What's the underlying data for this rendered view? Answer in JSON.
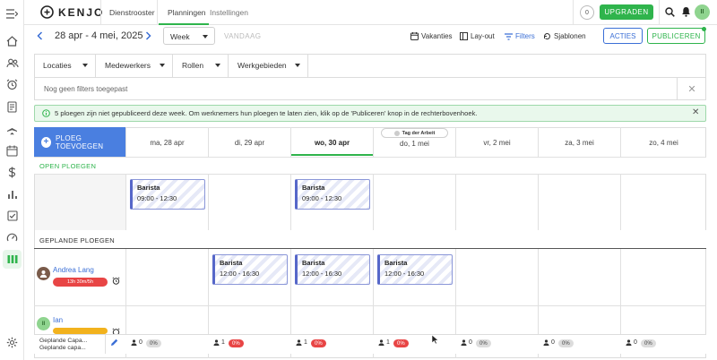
{
  "brand": {
    "name": "KENJO"
  },
  "topbar": {
    "section": "Dienstrooster",
    "tabs": [
      {
        "label": "Planningen"
      },
      {
        "label": "Instellingen"
      }
    ],
    "credits": "0",
    "upgrade_label": "UPGRADEN",
    "avatar_initials": "II"
  },
  "toolbar": {
    "date_range": "28 apr - 4 mei, 2025",
    "view_select": "Week",
    "today_label": "VANDAAG",
    "holidays_label": "Vakanties",
    "layout_label": "Lay-out",
    "filters_label": "Filters",
    "templates_label": "Sjablonen",
    "actions_label": "ACTIES",
    "publish_label": "PUBLICEREN"
  },
  "filters": {
    "dropdowns": [
      {
        "label": "Locaties"
      },
      {
        "label": "Medewerkers"
      },
      {
        "label": "Rollen"
      },
      {
        "label": "Werkgebieden"
      }
    ],
    "empty_text": "Nog geen filters toegepast"
  },
  "banner": {
    "text": "5 ploegen zijn niet gepubliceerd deze week. Om werknemers hun ploegen te laten zien, klik op de 'Publiceren' knop in de rechterbovenhoek."
  },
  "schedule": {
    "add_shift_label": "PLOEG TOEVOEGEN",
    "days": [
      {
        "label": "ma, 28 apr"
      },
      {
        "label": "di, 29 apr"
      },
      {
        "label": "wo, 30 apr"
      },
      {
        "label": "do, 1 mei"
      },
      {
        "label": "vr, 2 mei"
      },
      {
        "label": "za, 3 mei"
      },
      {
        "label": "zo, 4 mei"
      }
    ],
    "active_day": "wo, 30 apr",
    "holiday_label": "Tag der Arbeit",
    "open_section_label": "OPEN PLOEGEN",
    "planned_section_label": "GEPLANDE PLOEGEN",
    "open_shifts": [
      {
        "day": "ma, 28 apr",
        "role": "Barista",
        "time": "09:00 - 12:30"
      },
      {
        "day": "wo, 30 apr",
        "role": "Barista",
        "time": "09:00 - 12:30"
      }
    ],
    "employees": [
      {
        "name": "Andrea Lang",
        "hours": "13h 30m/5h",
        "hours_color": "#e84545",
        "shifts": [
          {
            "day": "di, 29 apr",
            "role": "Barista",
            "time": "12:00 - 16:30"
          },
          {
            "day": "wo, 30 apr",
            "role": "Barista",
            "time": "12:00 - 16:30"
          },
          {
            "day": "do, 1 mei",
            "role": "Barista",
            "time": "12:00 - 16:30"
          }
        ]
      },
      {
        "name": "Ian",
        "initials": "II",
        "hours_color": "#f2b21d"
      }
    ],
    "footer": {
      "labels": [
        "Geplande Capa...",
        "Geplande capa..."
      ],
      "counts": [
        {
          "count": "0",
          "pct": "0%",
          "status": "grey"
        },
        {
          "count": "1",
          "pct": "0%",
          "status": "red"
        },
        {
          "count": "1",
          "pct": "0%",
          "status": "red"
        },
        {
          "count": "1",
          "pct": "0%",
          "status": "red"
        },
        {
          "count": "0",
          "pct": "0%",
          "status": "grey"
        },
        {
          "count": "0",
          "pct": "0%",
          "status": "grey"
        },
        {
          "count": "0",
          "pct": "0%",
          "status": "grey"
        }
      ]
    }
  },
  "colors": {
    "accent_green": "#2fb44c",
    "accent_blue": "#3b6fd6",
    "warning_red": "#e84545",
    "warning_yellow": "#f2b21d"
  },
  "icons": [
    "menu-collapse-icon",
    "home-icon",
    "people-icon",
    "alarm-icon",
    "document-icon",
    "plane-icon",
    "calendar-icon",
    "dollar-icon",
    "bar-chart-icon",
    "checklist-icon",
    "gauge-icon",
    "schedule-icon",
    "settings-icon"
  ]
}
